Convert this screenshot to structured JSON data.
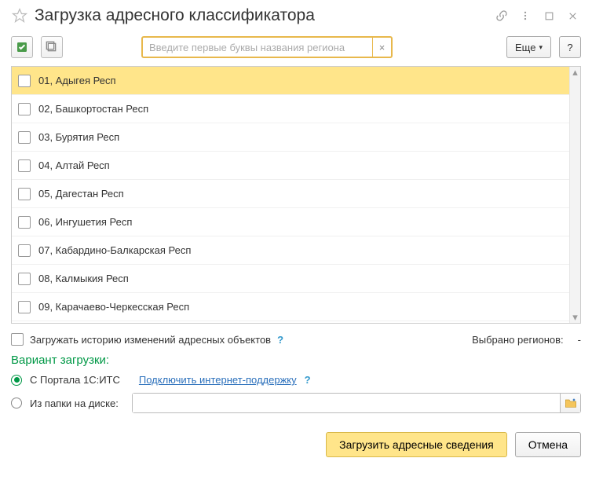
{
  "title": "Загрузка адресного классификатора",
  "search": {
    "placeholder": "Введите первые буквы названия региона"
  },
  "more_label": "Еще",
  "help_label": "?",
  "regions": [
    "01, Адыгея Респ",
    "02, Башкортостан Респ",
    "03, Бурятия Респ",
    "04, Алтай Респ",
    "05, Дагестан Респ",
    "06, Ингушетия Респ",
    "07, Кабардино-Балкарская Респ",
    "08, Калмыкия Респ",
    "09, Карачаево-Черкесская Респ"
  ],
  "load_history_label": "Загружать историю изменений адресных объектов",
  "selected_label": "Выбрано регионов:",
  "selected_value": "-",
  "variant_label": "Вариант загрузки:",
  "radio_portal": "С Портала 1С:ИТС",
  "connect_link": "Подключить интернет-поддержку",
  "radio_folder": "Из папки на диске:",
  "load_button": "Загрузить адресные сведения",
  "cancel_button": "Отмена"
}
